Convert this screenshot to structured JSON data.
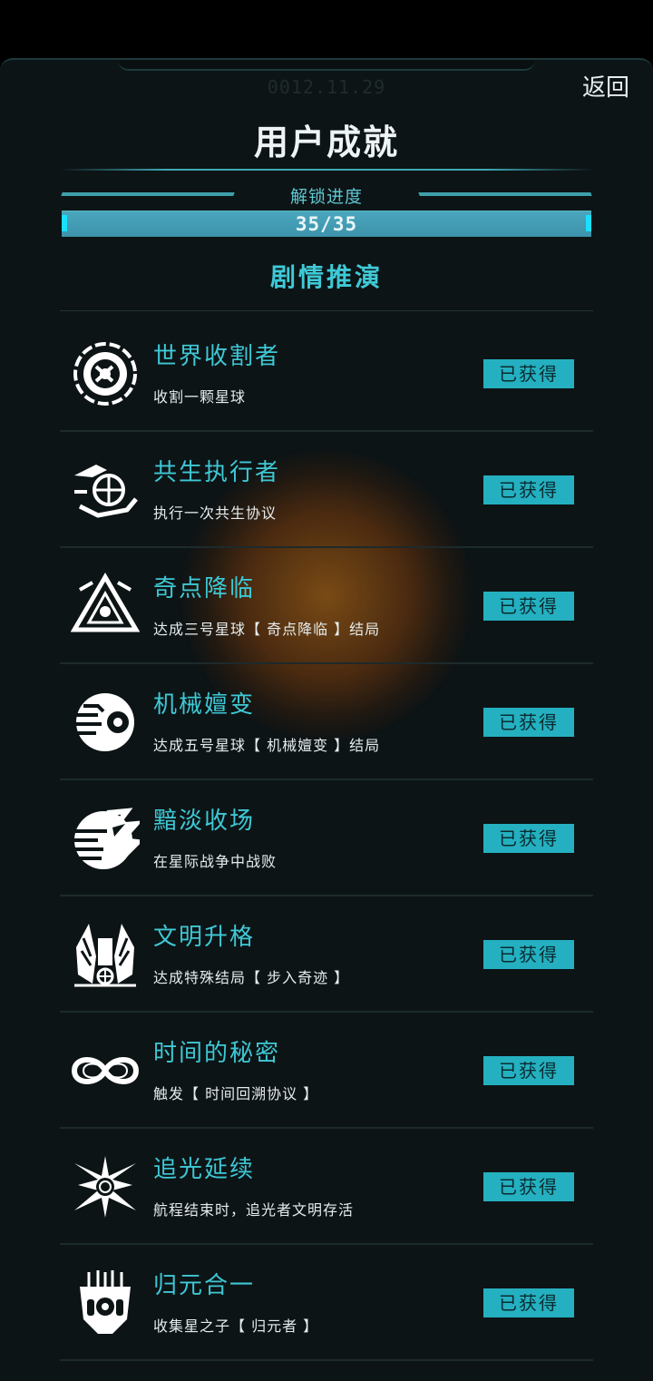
{
  "header": {
    "date": "0012.11.29",
    "back_label": "返回",
    "title": "用户成就"
  },
  "progress": {
    "label": "解锁进度",
    "text": "35/35",
    "unlocked": 35,
    "total": 35,
    "fraction": 1.0
  },
  "section": {
    "title": "剧情推演"
  },
  "colors": {
    "accent": "#3ec8d5",
    "badge_bg": "#24b0c0",
    "panel_bg": "#0d1416"
  },
  "achievements": [
    {
      "title": "世界收割者",
      "desc": "收割一颗星球",
      "status": "已获得",
      "icon": "harvester-icon"
    },
    {
      "title": "共生执行者",
      "desc": "执行一次共生协议",
      "status": "已获得",
      "icon": "symbiosis-hand-globe-icon"
    },
    {
      "title": "奇点降临",
      "desc": "达成三号星球【 奇点降临 】结局",
      "status": "已获得",
      "icon": "singularity-triangle-icon"
    },
    {
      "title": "机械嬗变",
      "desc": "达成五号星球【 机械嬗变 】结局",
      "status": "已获得",
      "icon": "mechanical-eye-icon"
    },
    {
      "title": "黯淡收场",
      "desc": "在星际战争中战败",
      "status": "已获得",
      "icon": "shattered-planet-icon"
    },
    {
      "title": "文明升格",
      "desc": "达成特殊结局【 步入奇迹 】",
      "status": "已获得",
      "icon": "winged-emblem-icon"
    },
    {
      "title": "时间的秘密",
      "desc": "触发【 时间回溯协议 】",
      "status": "已获得",
      "icon": "infinity-icon"
    },
    {
      "title": "追光延续",
      "desc": "航程结束时，追光者文明存活",
      "status": "已获得",
      "icon": "radiant-star-icon"
    },
    {
      "title": "归元合一",
      "desc": "收集星之子【 归元者 】",
      "status": "已获得",
      "icon": "circuit-mask-icon"
    }
  ]
}
